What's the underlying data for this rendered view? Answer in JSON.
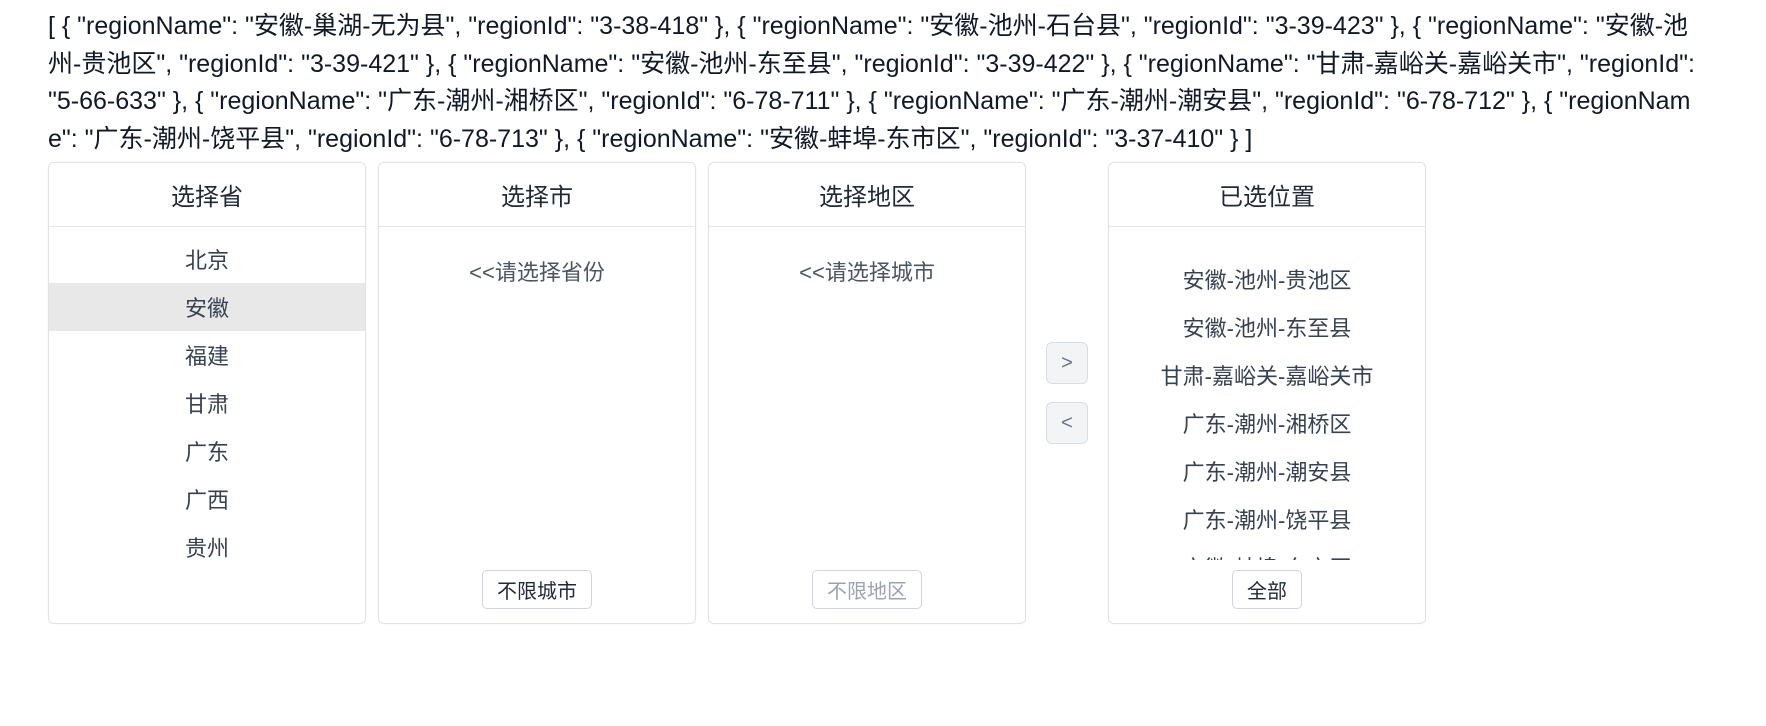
{
  "json_dump_text": "[ { \"regionName\": \"安徽-巢湖-无为县\", \"regionId\": \"3-38-418\" }, { \"regionName\": \"安徽-池州-石台县\", \"regionId\": \"3-39-423\" }, { \"regionName\": \"安徽-池州-贵池区\", \"regionId\": \"3-39-421\" }, { \"regionName\": \"安徽-池州-东至县\", \"regionId\": \"3-39-422\" }, { \"regionName\": \"甘肃-嘉峪关-嘉峪关市\", \"regionId\": \"5-66-633\" }, { \"regionName\": \"广东-潮州-湘桥区\", \"regionId\": \"6-78-711\" }, { \"regionName\": \"广东-潮州-潮安县\", \"regionId\": \"6-78-712\" }, { \"regionName\": \"广东-潮州-饶平县\", \"regionId\": \"6-78-713\" }, { \"regionName\": \"安徽-蚌埠-东市区\", \"regionId\": \"3-37-410\" } ]",
  "panels": {
    "province": {
      "title": "选择省",
      "items": [
        "北京",
        "安徽",
        "福建",
        "甘肃",
        "广东",
        "广西",
        "贵州"
      ],
      "hovered_index": 1
    },
    "city": {
      "title": "选择市",
      "placeholder": "<<请选择省份",
      "footer_button": "不限城市",
      "footer_disabled": false
    },
    "district": {
      "title": "选择地区",
      "placeholder": "<<请选择城市",
      "footer_button": "不限地区",
      "footer_disabled": true
    },
    "selected": {
      "title": "已选位置",
      "items": [
        "安徽-池州-贵池区",
        "安徽-池州-东至县",
        "甘肃-嘉峪关-嘉峪关市",
        "广东-潮州-湘桥区",
        "广东-潮州-潮安县",
        "广东-潮州-饶平县",
        "安徽-蚌埠-东市区"
      ],
      "footer_button": "全部"
    }
  },
  "transfer": {
    "add_icon": ">",
    "remove_icon": "<"
  }
}
